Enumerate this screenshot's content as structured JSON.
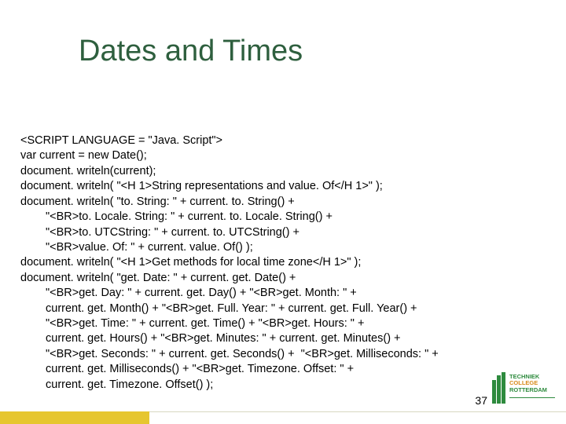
{
  "title": "Dates and Times",
  "code": {
    "l1": "<SCRIPT LANGUAGE = \"Java. Script\">",
    "l2": "var current = new Date();",
    "l3": "document. writeln(current);",
    "l4": "document. writeln( \"<H 1>String representations and value. Of</H 1>\" );",
    "l5": "document. writeln( \"to. String: \" + current. to. String() +",
    "l6": "\"<BR>to. Locale. String: \" + current. to. Locale. String() +",
    "l7": "\"<BR>to. UTCString: \" + current. to. UTCString() +",
    "l8": "\"<BR>value. Of: \" + current. value. Of() );",
    "l9": "document. writeln( \"<H 1>Get methods for local time zone</H 1>\" );",
    "l10": "document. writeln( \"get. Date: \" + current. get. Date() +",
    "l11": "\"<BR>get. Day: \" + current. get. Day() + \"<BR>get. Month: \" +",
    "l12": "current. get. Month() + \"<BR>get. Full. Year: \" + current. get. Full. Year() +",
    "l13": "\"<BR>get. Time: \" + current. get. Time() + \"<BR>get. Hours: \" +",
    "l14": "current. get. Hours() + \"<BR>get. Minutes: \" + current. get. Minutes() +",
    "l15": "\"<BR>get. Seconds: \" + current. get. Seconds() +  \"<BR>get. Milliseconds: \" +",
    "l16": "current. get. Milliseconds() + \"<BR>get. Timezone. Offset: \" +",
    "l17": "current. get. Timezone. Offset() );"
  },
  "pagenum": "37",
  "logo": {
    "t1": "TECHNIEK",
    "t2": "COLLEGE",
    "t3": "ROTTERDAM"
  }
}
